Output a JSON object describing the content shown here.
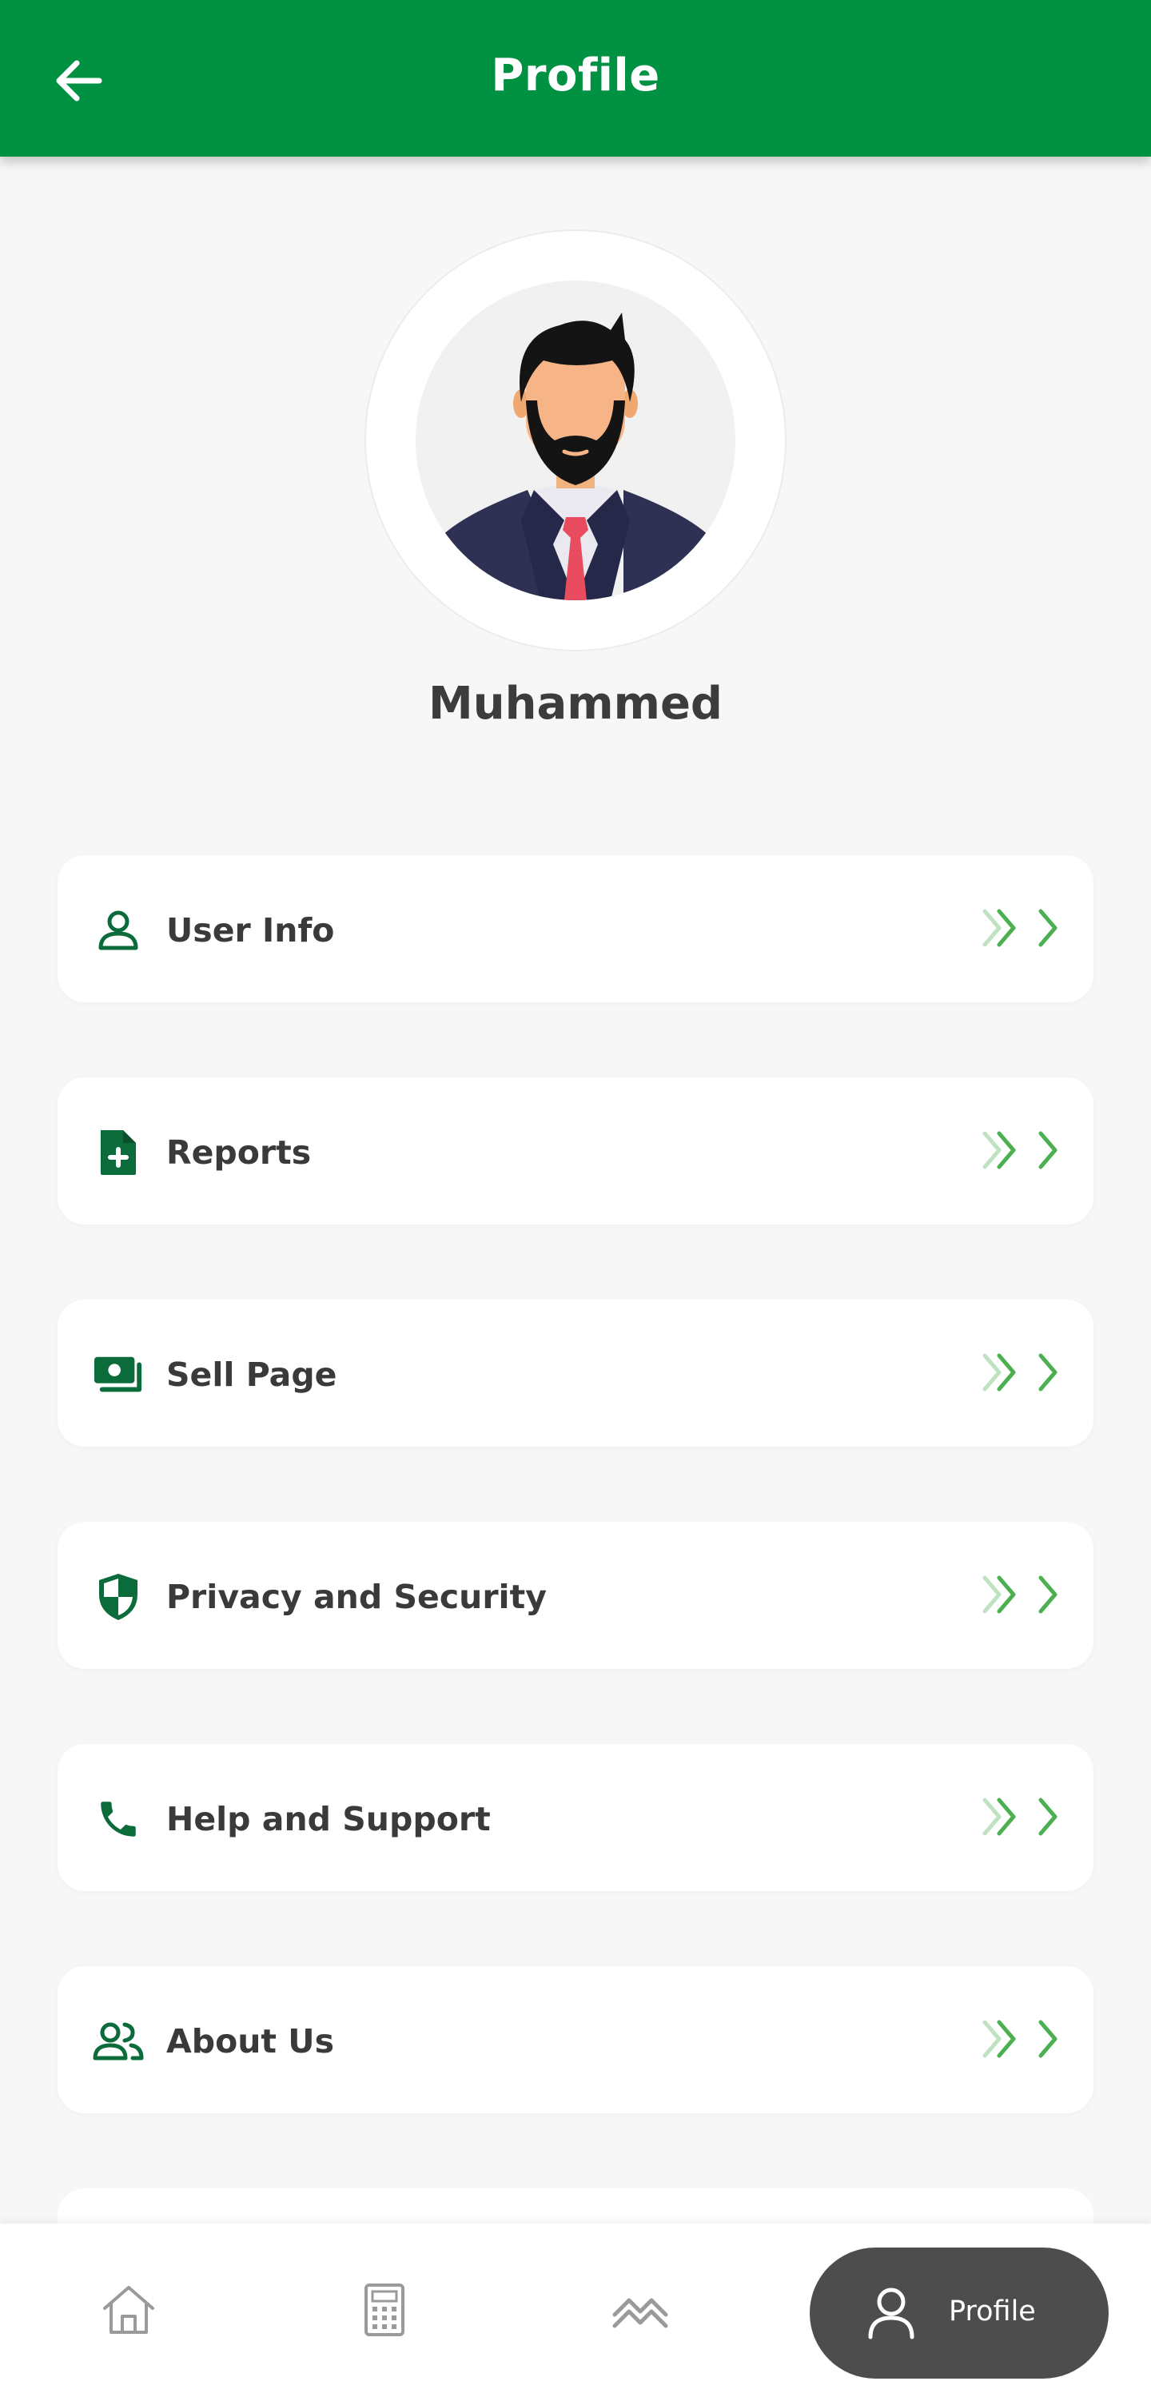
{
  "header": {
    "title": "Profile",
    "back_icon": "arrow-left-icon",
    "background_color": "#019143"
  },
  "profile": {
    "name": "Muhammed",
    "avatar": "man-with-beard-avatar"
  },
  "menu": {
    "items": [
      {
        "label": "User Info",
        "icon": "user-icon"
      },
      {
        "label": "Reports",
        "icon": "file-plus-icon"
      },
      {
        "label": "Sell Page",
        "icon": "money-icon"
      },
      {
        "label": "Privacy and Security",
        "icon": "shield-icon"
      },
      {
        "label": "Help and Support",
        "icon": "phone-icon"
      },
      {
        "label": "About Us",
        "icon": "people-icon"
      }
    ],
    "chevron_icon": "double-chevron-right-icon",
    "icon_color": "#0b6b3a",
    "chevron_color": "#4caf50"
  },
  "bottom_nav": {
    "items": [
      {
        "name": "home",
        "icon": "home-icon"
      },
      {
        "name": "calculator",
        "icon": "calculator-icon"
      },
      {
        "name": "chart",
        "icon": "chart-icon"
      }
    ],
    "active": {
      "label": "Profile",
      "icon": "user-icon"
    },
    "active_color": "#4d4d4d"
  }
}
